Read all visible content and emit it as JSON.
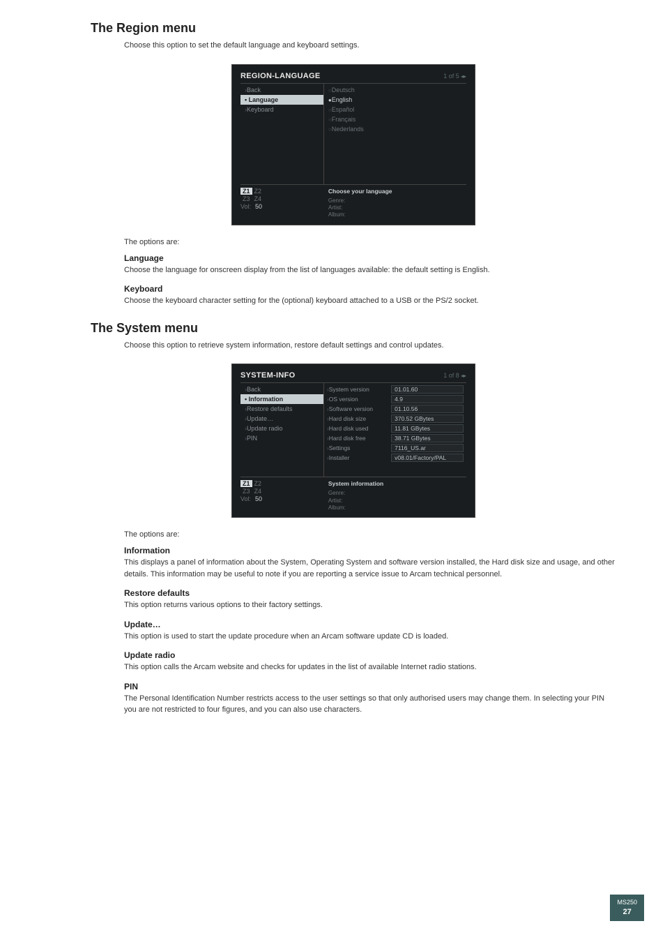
{
  "region": {
    "heading": "The Region menu",
    "intro": "Choose this option to set the default language and keyboard settings.",
    "options_intro": "The options are:",
    "options": [
      {
        "title": "Language",
        "desc": "Choose the language for onscreen display from the list of languages available: the default setting is English."
      },
      {
        "title": "Keyboard",
        "desc": "Choose the keyboard character setting for the (optional) keyboard attached to a USB or the PS/2 socket."
      }
    ],
    "screen": {
      "title": "REGION-LANGUAGE",
      "counter": "1 of 5",
      "nav": [
        {
          "label": "Back",
          "selected": false
        },
        {
          "label": "Language",
          "selected": true
        },
        {
          "label": "Keyboard",
          "selected": false
        }
      ],
      "langs": [
        {
          "label": "Deutsch",
          "picked": false
        },
        {
          "label": "English",
          "picked": true
        },
        {
          "label": "Español",
          "picked": false
        },
        {
          "label": "Français",
          "picked": false
        },
        {
          "label": "Nederlands",
          "picked": false
        }
      ],
      "hint": "Choose your language"
    }
  },
  "system": {
    "heading": "The System menu",
    "intro": "Choose this option to retrieve system information, restore default settings and control updates.",
    "options_intro": "The options are:",
    "options": [
      {
        "title": "Information",
        "desc": "This displays a panel of information about the System, Operating System and software version installed, the Hard disk size and usage, and other details. This information may be useful to note if you are reporting a service issue to Arcam technical personnel."
      },
      {
        "title": "Restore defaults",
        "desc": "This option returns various options to their factory settings."
      },
      {
        "title": "Update…",
        "desc": "This option is used to start the update procedure when an Arcam software update CD is loaded."
      },
      {
        "title": "Update radio",
        "desc": "This option calls the Arcam website and checks for updates in the list of available Internet radio stations."
      },
      {
        "title": "PIN",
        "desc": "The Personal Identification Number restricts access to the user settings so that only authorised users may change them. In selecting your PIN you are not restricted to four figures, and you can also use characters."
      }
    ],
    "screen": {
      "title": "SYSTEM-INFO",
      "counter": "1 of 8",
      "nav": [
        {
          "label": "Back",
          "selected": false
        },
        {
          "label": "Information",
          "selected": true
        },
        {
          "label": "Restore defaults",
          "selected": false
        },
        {
          "label": "Update…",
          "selected": false
        },
        {
          "label": "Update radio",
          "selected": false
        },
        {
          "label": "PIN",
          "selected": false
        }
      ],
      "info": [
        {
          "label": "System version",
          "value": "01.01.60"
        },
        {
          "label": "OS version",
          "value": "4.9"
        },
        {
          "label": "Software version",
          "value": "01.10.56"
        },
        {
          "label": "Hard disk size",
          "value": "370.52 GBytes"
        },
        {
          "label": "Hard disk used",
          "value": "11.81 GBytes"
        },
        {
          "label": "Hard disk free",
          "value": "38.71 GBytes"
        },
        {
          "label": "Settings",
          "value": "7116_US.ar"
        },
        {
          "label": "Installer",
          "value": "v08.01/Factory/PAL"
        }
      ],
      "hint": "System information"
    }
  },
  "footer_common": {
    "zones": [
      "Z1",
      "Z2",
      "Z3",
      "Z4"
    ],
    "vol_label": "Vol:",
    "vol_value": "50",
    "meta_labels": [
      "Genre:",
      "Artist:",
      "Album:"
    ]
  },
  "page_badge": {
    "model": "MS250",
    "page": "27"
  }
}
